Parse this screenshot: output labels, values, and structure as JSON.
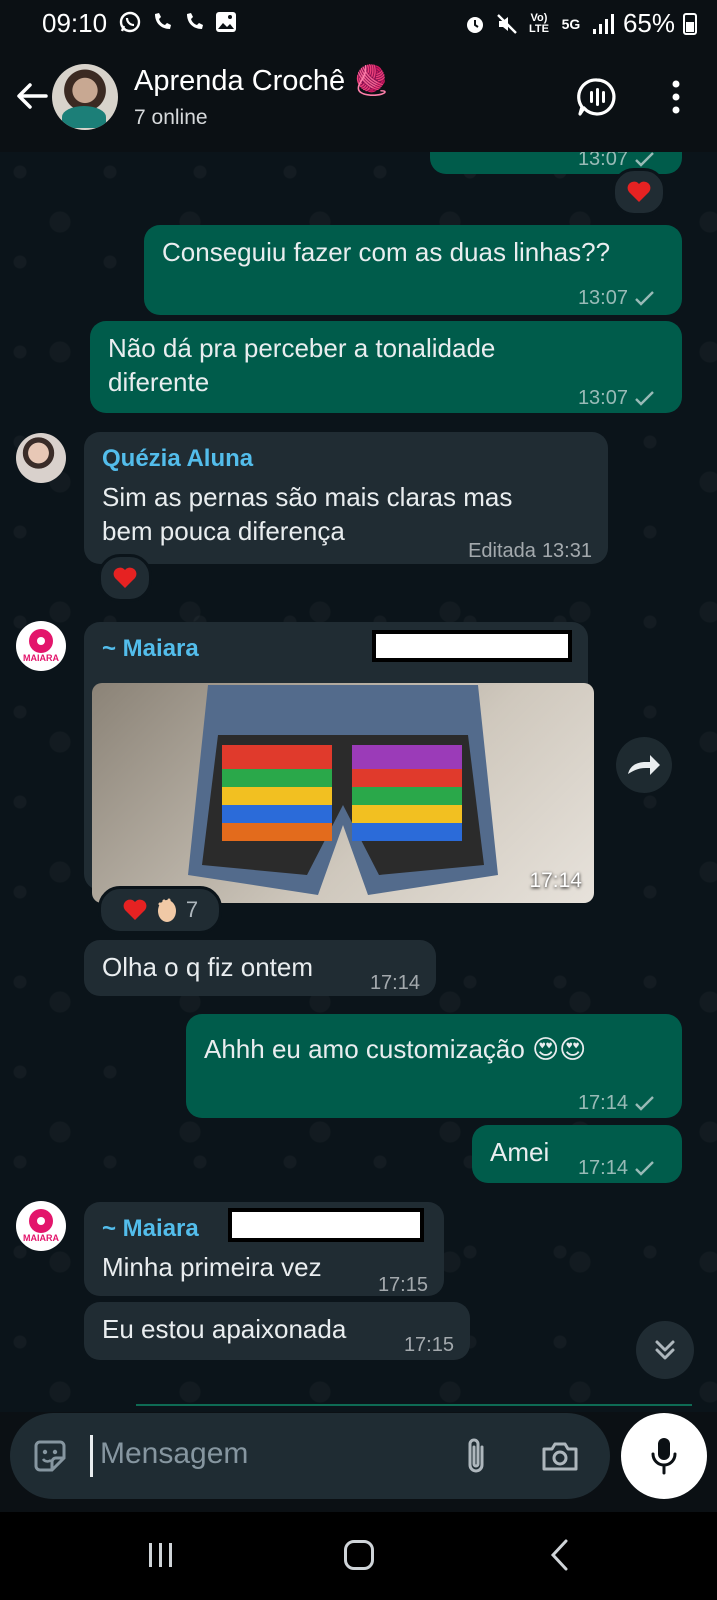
{
  "status_bar": {
    "time": "09:10",
    "battery": "65%",
    "network": "5G"
  },
  "header": {
    "title": "Aprenda Crochê",
    "title_emoji": "🧶",
    "subtitle": "7 online"
  },
  "messages": {
    "m0": {
      "time": "13:07"
    },
    "m1": {
      "text": "Conseguiu fazer com as duas linhas??",
      "time": "13:07"
    },
    "m2": {
      "text_line1": "Não dá pra perceber a tonalidade",
      "text_line2": "diferente",
      "time": "13:07"
    },
    "m3": {
      "sender": "Quézia Aluna",
      "text_line1": "Sim as pernas são mais claras mas",
      "text_line2": "bem pouca diferença",
      "edited_label": "Editada",
      "time": "13:31"
    },
    "m4": {
      "sender": "~ Maiara",
      "photo_time": "17:14",
      "reaction_count": "7"
    },
    "m5": {
      "text": "Olha o q fiz ontem",
      "time": "17:14"
    },
    "m6": {
      "text": "Ahhh eu amo customização 😍😍",
      "time": "17:14"
    },
    "m7": {
      "text": "Amei",
      "time": "17:14"
    },
    "m8": {
      "sender": "~ Maiara",
      "text": "Minha primeira vez",
      "time": "17:15"
    },
    "m9": {
      "text": "Eu estou apaixonada",
      "time": "17:15"
    }
  },
  "input": {
    "placeholder": "Mensagem"
  },
  "avatar_text": {
    "maiara": "MAIARA"
  },
  "colors": {
    "outgoing_bubble": "#005c4b",
    "incoming_bubble": "#202c33",
    "sender_quezia": "#53bdeb",
    "sender_maiara": "#53bdeb",
    "background": "#0b141a"
  },
  "icons": {
    "back": "arrow-left-icon",
    "call": "voice-chat-icon",
    "menu": "more-vertical-icon",
    "forward": "forward-icon",
    "scroll": "chevron-double-down-icon",
    "emoji": "sticker-icon",
    "attach": "paperclip-icon",
    "camera": "camera-icon",
    "mic": "microphone-icon"
  }
}
